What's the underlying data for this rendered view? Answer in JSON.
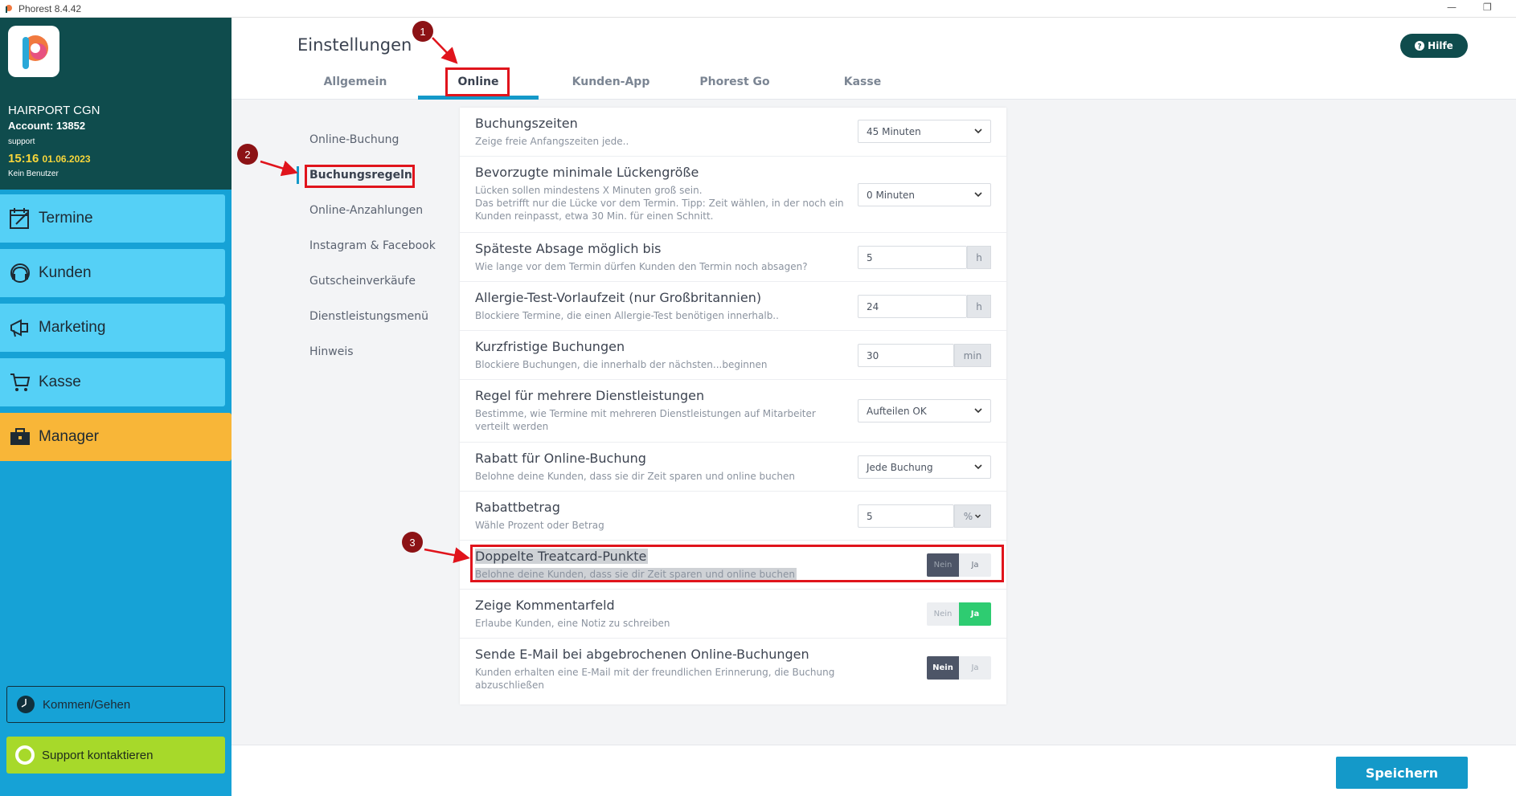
{
  "window": {
    "title": "Phorest 8.4.42"
  },
  "colors": {
    "brand_dark": "#0f4c4d",
    "accent": "#1499c9",
    "nav": "#55d0f6",
    "nav_active": "#f8b638",
    "toggle_on": "#2ecc71",
    "annotation": "#e0141c"
  },
  "account": {
    "salon": "HAIRPORT CGN",
    "account": "Account: 13852",
    "user": "support",
    "time": "15:16",
    "date": "01.06.2023",
    "no_user": "Kein Benutzer"
  },
  "sidebar": {
    "items": [
      {
        "label": "Termine",
        "icon": "calendar-edit-icon"
      },
      {
        "label": "Kunden",
        "icon": "headset-icon"
      },
      {
        "label": "Marketing",
        "icon": "megaphone-icon"
      },
      {
        "label": "Kasse",
        "icon": "cart-icon"
      },
      {
        "label": "Manager",
        "icon": "briefcase-icon"
      }
    ],
    "kommen": "Kommen/Gehen",
    "support": "Support kontaktieren"
  },
  "header": {
    "title": "Einstellungen",
    "tabs": [
      "Allgemein",
      "Online",
      "Kunden-App",
      "Phorest Go",
      "Kasse"
    ],
    "active_tab": "Online",
    "help": "Hilfe"
  },
  "subnav": [
    "Online-Buchung",
    "Buchungsregeln",
    "Online-Anzahlungen",
    "Instagram & Facebook",
    "Gutscheinverkäufe",
    "Dienstleistungsmenü",
    "Hinweis"
  ],
  "settings": [
    {
      "title": "Buchungszeiten",
      "desc": "Zeige freie Anfangszeiten jede..",
      "value": "45 Minuten"
    },
    {
      "title": "Bevorzugte minimale Lückengröße",
      "desc": "Lücken sollen mindestens X Minuten groß sein.",
      "desc2": "Das betrifft nur die Lücke vor dem Termin. Tipp: Zeit wählen, in der noch ein Kunden reinpasst, etwa 30 Min. für einen Schnitt.",
      "value": "0 Minuten"
    },
    {
      "title": "Späteste Absage möglich bis",
      "desc": "Wie lange vor dem Termin dürfen Kunden den Termin noch absagen?",
      "value": "5",
      "unit": "h"
    },
    {
      "title": "Allergie-Test-Vorlaufzeit (nur Großbritannien)",
      "desc": "Blockiere Termine, die einen Allergie-Test benötigen innerhalb..",
      "value": "24",
      "unit": "h"
    },
    {
      "title": "Kurzfristige Buchungen",
      "desc": "Blockiere Buchungen, die innerhalb der nächsten...beginnen",
      "value": "30",
      "unit": "min"
    },
    {
      "title": "Regel für mehrere Dienstleistungen",
      "desc": "Bestimme, wie Termine mit mehreren Dienstleistungen auf Mitarbeiter verteilt werden",
      "value": "Aufteilen OK"
    },
    {
      "title": "Rabatt für Online-Buchung",
      "desc": "Belohne deine Kunden, dass sie dir Zeit sparen und online buchen",
      "value": "Jede Buchung"
    },
    {
      "title": "Rabattbetrag",
      "desc": "Wähle Prozent oder Betrag",
      "value": "5",
      "unit": "%"
    },
    {
      "title": "Doppelte Treatcard-Punkte",
      "desc": "Belohne deine Kunden, dass sie dir Zeit sparen und online buchen",
      "no": "Nein",
      "yes": "Ja"
    },
    {
      "title": "Zeige Kommentarfeld",
      "desc": "Erlaube Kunden, eine Notiz zu schreiben",
      "no": "Nein",
      "yes": "Ja"
    },
    {
      "title": "Sende E-Mail bei abgebrochenen Online-Buchungen",
      "desc": "Kunden erhalten eine E-Mail mit der freundlichen Erinnerung, die Buchung abzuschließen",
      "no": "Nein",
      "yes": "Ja"
    }
  ],
  "footer": {
    "save": "Speichern"
  },
  "annotations": [
    "1",
    "2",
    "3"
  ]
}
